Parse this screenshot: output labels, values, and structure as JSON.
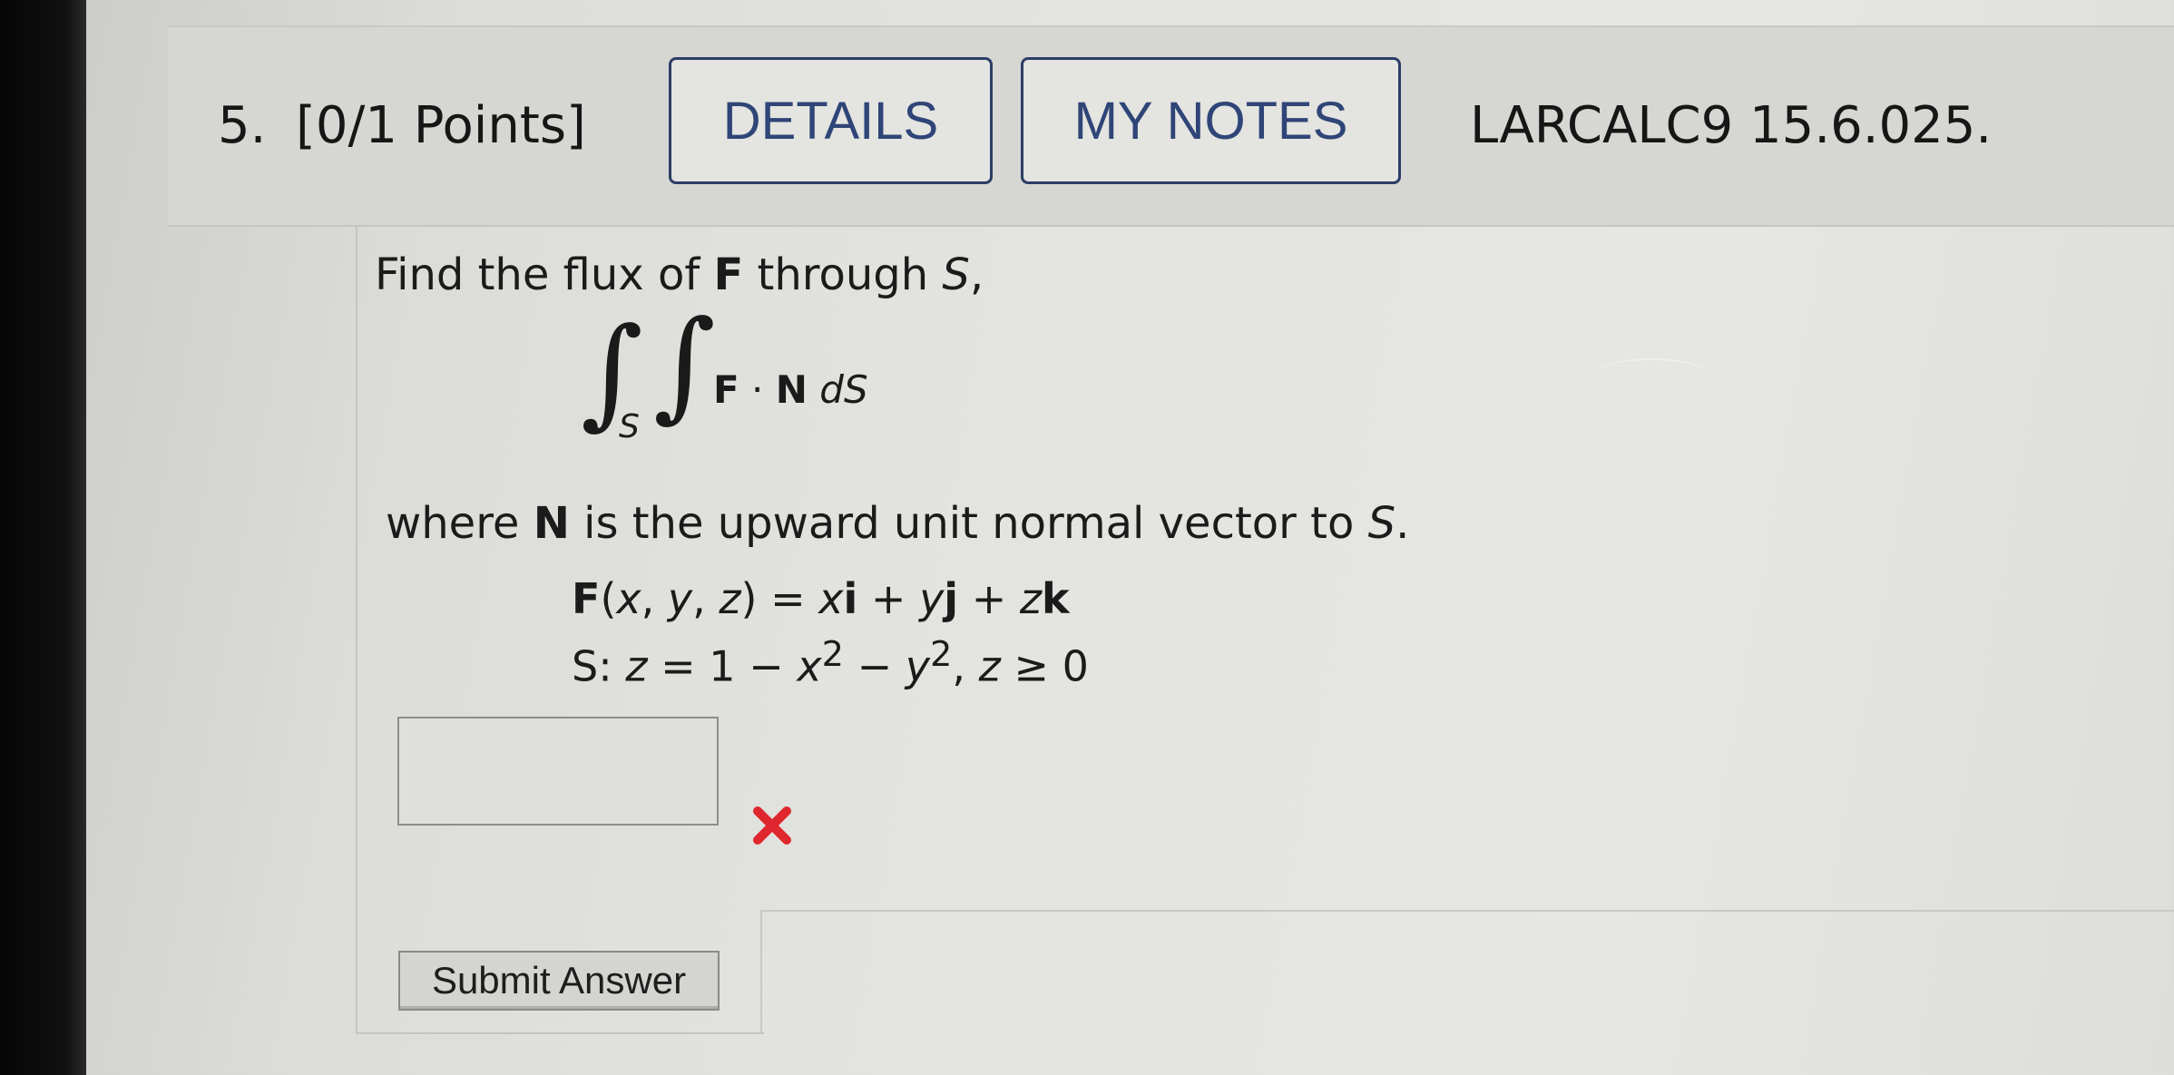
{
  "question": {
    "number": "5.",
    "points": "[0/1 Points]",
    "details_label": "DETAILS",
    "my_notes_label": "MY NOTES",
    "reference": "LARCALC9 15.6.025."
  },
  "problem": {
    "prompt_start": "Find the flux of ",
    "prompt_bold": "F",
    "prompt_mid": " through ",
    "prompt_italic": "S",
    "prompt_end": ",",
    "integral_symbol": "∫",
    "integral_subscript": "S",
    "integrand_F": "F",
    "integrand_dot": " · ",
    "integrand_N": "N",
    "integrand_d": " d",
    "integrand_S": "S",
    "where_start": "where ",
    "where_bold": "N",
    "where_mid": " is the upward unit normal vector to ",
    "where_italic": "S",
    "where_end": "."
  },
  "formulas": {
    "f_name": "F",
    "f_args_open": "(",
    "f_x": "x",
    "f_comma1": ", ",
    "f_y": "y",
    "f_comma2": ", ",
    "f_z": "z",
    "f_args_close": ") = ",
    "f_t1": "x",
    "f_i": "i",
    "f_plus1": " + ",
    "f_t2": "y",
    "f_j": "j",
    "f_plus2": " + ",
    "f_t3": "z",
    "f_k": "k",
    "s_label": "S",
    "s_colon": ": ",
    "s_z": "z",
    "s_eq": " = 1 − ",
    "s_x": "x",
    "s_exp1": "2",
    "s_minus": " − ",
    "s_y": "y",
    "s_exp2": "2",
    "s_comma": ",  ",
    "s_z2": "z",
    "s_cond": " ≥ 0"
  },
  "answer": {
    "value": "",
    "status": "incorrect",
    "status_icon": "x-mark-icon",
    "status_color": "#e0262e"
  },
  "submit": {
    "label": "Submit Answer"
  },
  "colors": {
    "button_border": "#2c3e66",
    "button_text": "#2f4578"
  }
}
